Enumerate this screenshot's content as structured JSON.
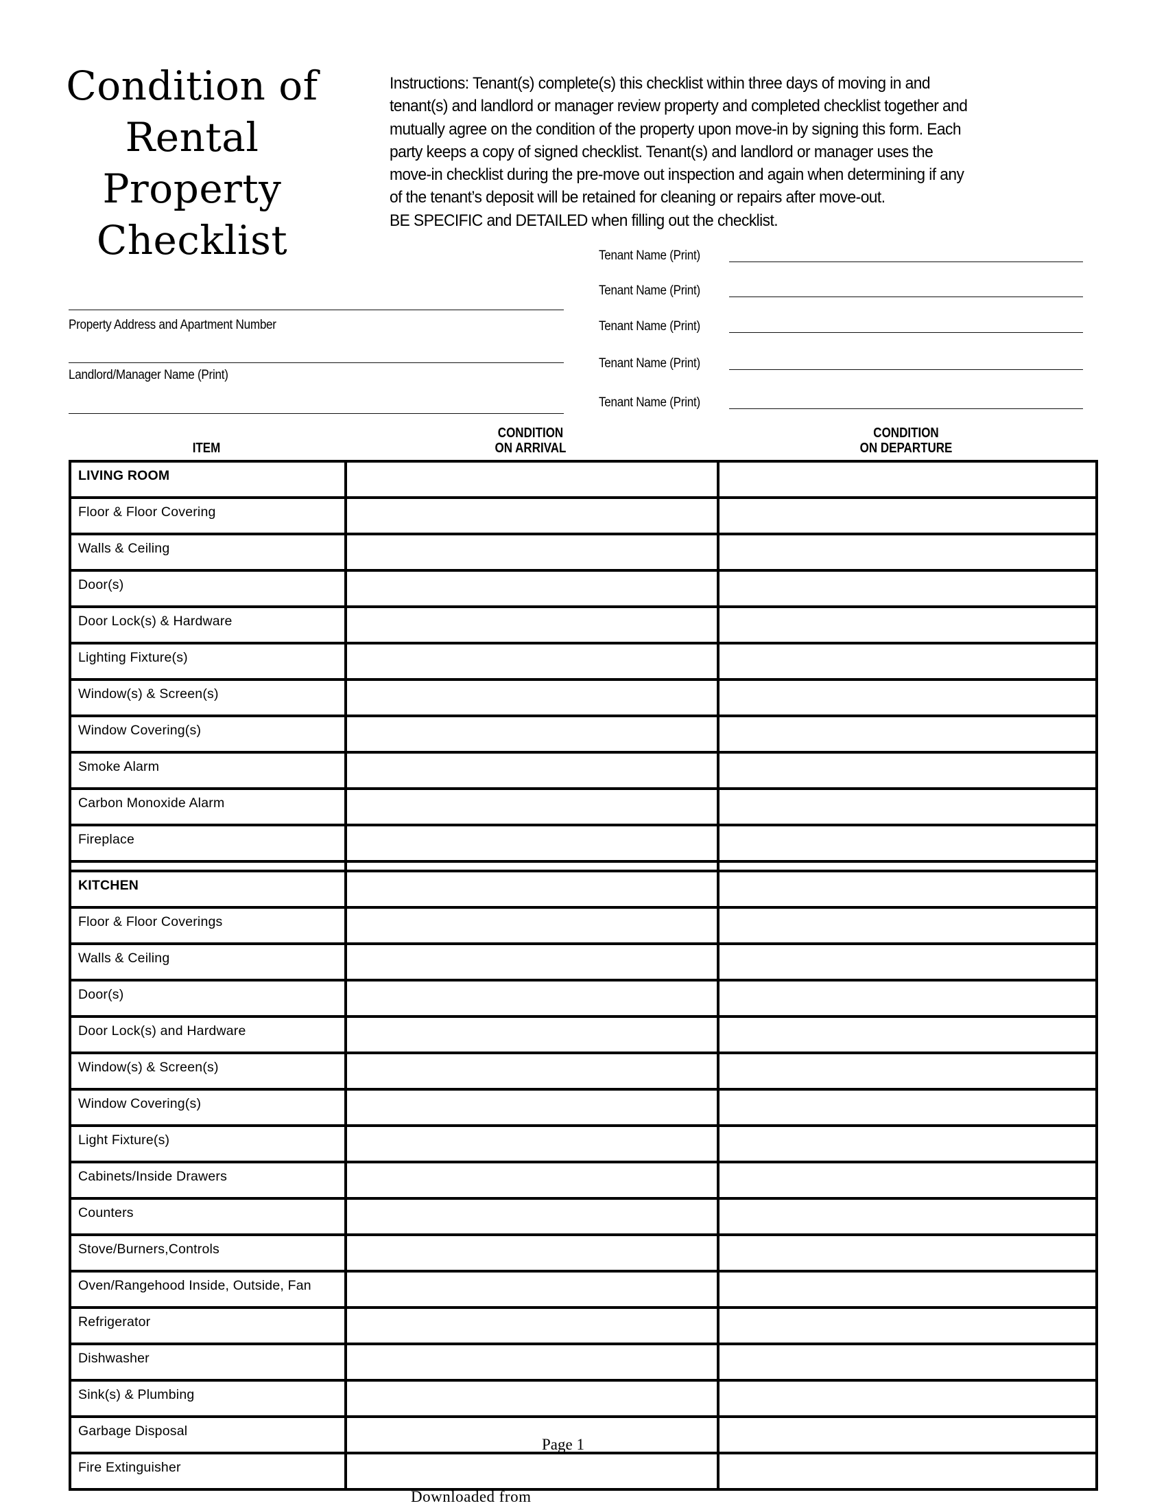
{
  "header": {
    "title_lines": [
      "Condition of",
      "Rental",
      "Property",
      "Checklist"
    ],
    "instructions": "Instructions:  Tenant(s) complete(s) this checklist within three days of moving in and\ntenant(s) and landlord or manager review property and completed checklist together and\nmutually agree on the condition of the property upon move-in by signing this form.  Each\nparty keeps a copy of signed checklist.  Tenant(s) and landlord or manager uses the\nmove-in checklist during the pre-move out inspection and again when determining if any\nof the tenant’s deposit will be retained for cleaning or repairs after move-out.\nBE SPECIFIC and DETAILED when filling out the checklist."
  },
  "fields": {
    "property_address_label": "Property Address and Apartment Number",
    "property_address_value": "",
    "landlord_label": "Landlord/Manager Name (Print)",
    "landlord_value": "",
    "tenants": [
      {
        "label": "Tenant Name (Print)",
        "value": ""
      },
      {
        "label": "Tenant Name (Print)",
        "value": ""
      },
      {
        "label": "Tenant Name (Print)",
        "value": ""
      },
      {
        "label": "Tenant Name (Print)",
        "value": ""
      },
      {
        "label": "Tenant Name (Print)",
        "value": ""
      }
    ]
  },
  "table": {
    "columns": {
      "item": "ITEM",
      "arrival_line1": "CONDITION",
      "arrival_line2": "ON ARRIVAL",
      "departure_line1": "CONDITION",
      "departure_line2": "ON DEPARTURE"
    },
    "living_room": {
      "section": "LIVING ROOM",
      "items": [
        "Floor & Floor Covering",
        "Walls & Ceiling",
        "Door(s)",
        "Door Lock(s) & Hardware",
        "Lighting Fixture(s)",
        "Window(s) & Screen(s)",
        "Window Covering(s)",
        "Smoke Alarm",
        "Carbon Monoxide Alarm",
        "Fireplace"
      ]
    },
    "kitchen": {
      "section": "KITCHEN",
      "items": [
        "Floor & Floor Coverings",
        "Walls & Ceiling",
        "Door(s)",
        "Door Lock(s) and Hardware",
        "Window(s) & Screen(s)",
        "Window Covering(s)",
        "Light Fixture(s)",
        "Cabinets/Inside Drawers",
        "Counters",
        "Stove/Burners,Controls",
        "Oven/Rangehood Inside, Outside, Fan",
        "Refrigerator",
        "Dishwasher",
        "Sink(s) & Plumbing",
        "Garbage Disposal",
        "Fire Extinguisher"
      ]
    }
  },
  "footer": {
    "page": "Page 1",
    "downloaded": "Downloaded from"
  }
}
